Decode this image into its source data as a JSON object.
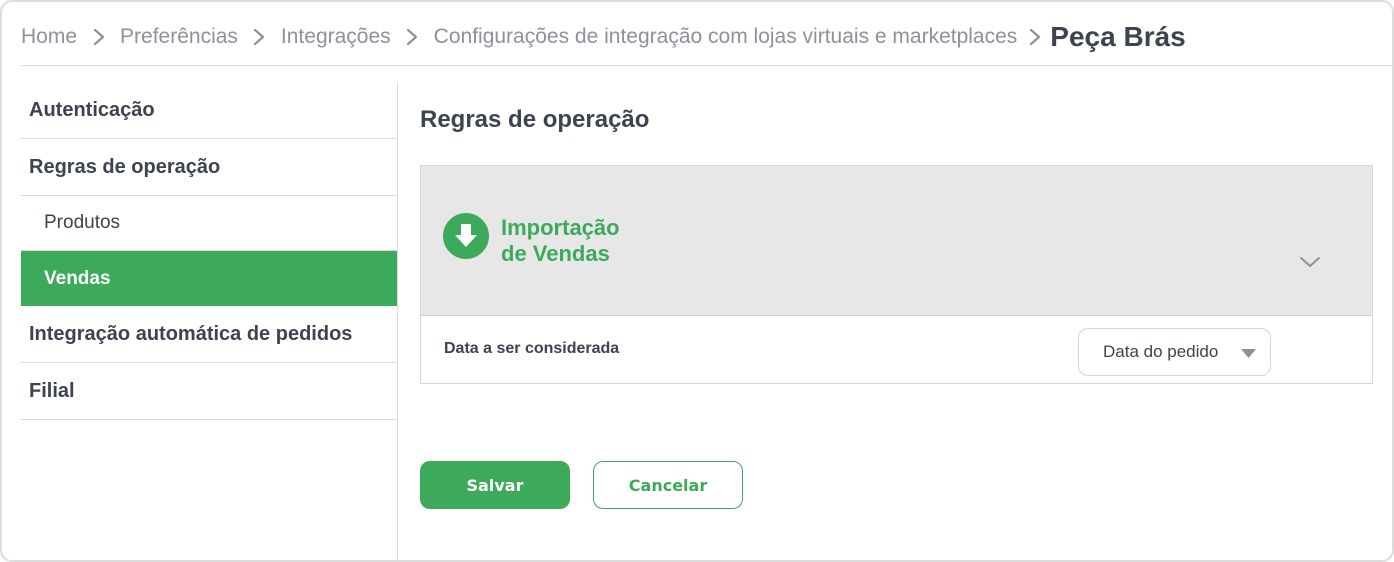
{
  "breadcrumb": {
    "items": [
      "Home",
      "Preferências",
      "Integrações",
      "Configurações de integração com lojas virtuais e marketplaces"
    ],
    "current": "Peça Brás"
  },
  "sidebar": {
    "items": [
      {
        "label": "Autenticação"
      },
      {
        "label": "Regras de operação"
      },
      {
        "label": "Produtos"
      },
      {
        "label": "Vendas"
      },
      {
        "label": "Integração automática de pedidos"
      },
      {
        "label": "Filial"
      }
    ],
    "active": "Vendas"
  },
  "main": {
    "title": "Regras de operação",
    "card": {
      "title_line1": "Importação",
      "title_line2": "de Vendas",
      "icon": "download-circle-icon",
      "row_label": "Data a ser considerada",
      "select_value": "Data do pedido"
    }
  },
  "actions": {
    "save_label": "Salvar",
    "cancel_label": "Cancelar"
  },
  "colors": {
    "accent": "#3daa5b",
    "text": "#3d4350",
    "muted": "#8c919b",
    "header_bg": "#e7e7e7"
  }
}
